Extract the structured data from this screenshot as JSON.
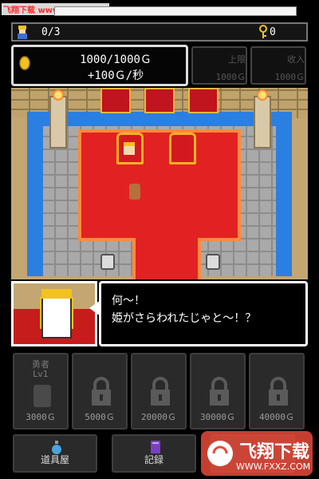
{
  "watermark_top": "飞翔下载 www.FXXZ.com",
  "status": {
    "hero_count": "0/3",
    "key_count": "0"
  },
  "gold": {
    "amount": "1000/1000Ｇ",
    "rate": "+100Ｇ/秒"
  },
  "upgrades": [
    {
      "label": "上限",
      "cost": "1000Ｇ"
    },
    {
      "label": "收入",
      "cost": "1000Ｇ"
    }
  ],
  "dialog": {
    "line1": "何～！",
    "line2": "姫がさらわれたじゃと～！？"
  },
  "hero_slots": [
    {
      "name": "勇者",
      "level": "Lv1",
      "price": "3000Ｇ",
      "locked": false
    },
    {
      "price": "5000Ｇ",
      "locked": true
    },
    {
      "price": "20000Ｇ",
      "locked": true
    },
    {
      "price": "30000Ｇ",
      "locked": true
    },
    {
      "price": "40000Ｇ",
      "locked": true
    }
  ],
  "nav": {
    "shop_label": "道具屋",
    "records_label": "記録"
  },
  "watermark_logo": {
    "title": "飞翔下载",
    "url": "WWW.FXXZ.COM"
  },
  "colors": {
    "carpet": "#e22222",
    "water": "#2b7fe0",
    "gold_border": "#f2b41e"
  }
}
